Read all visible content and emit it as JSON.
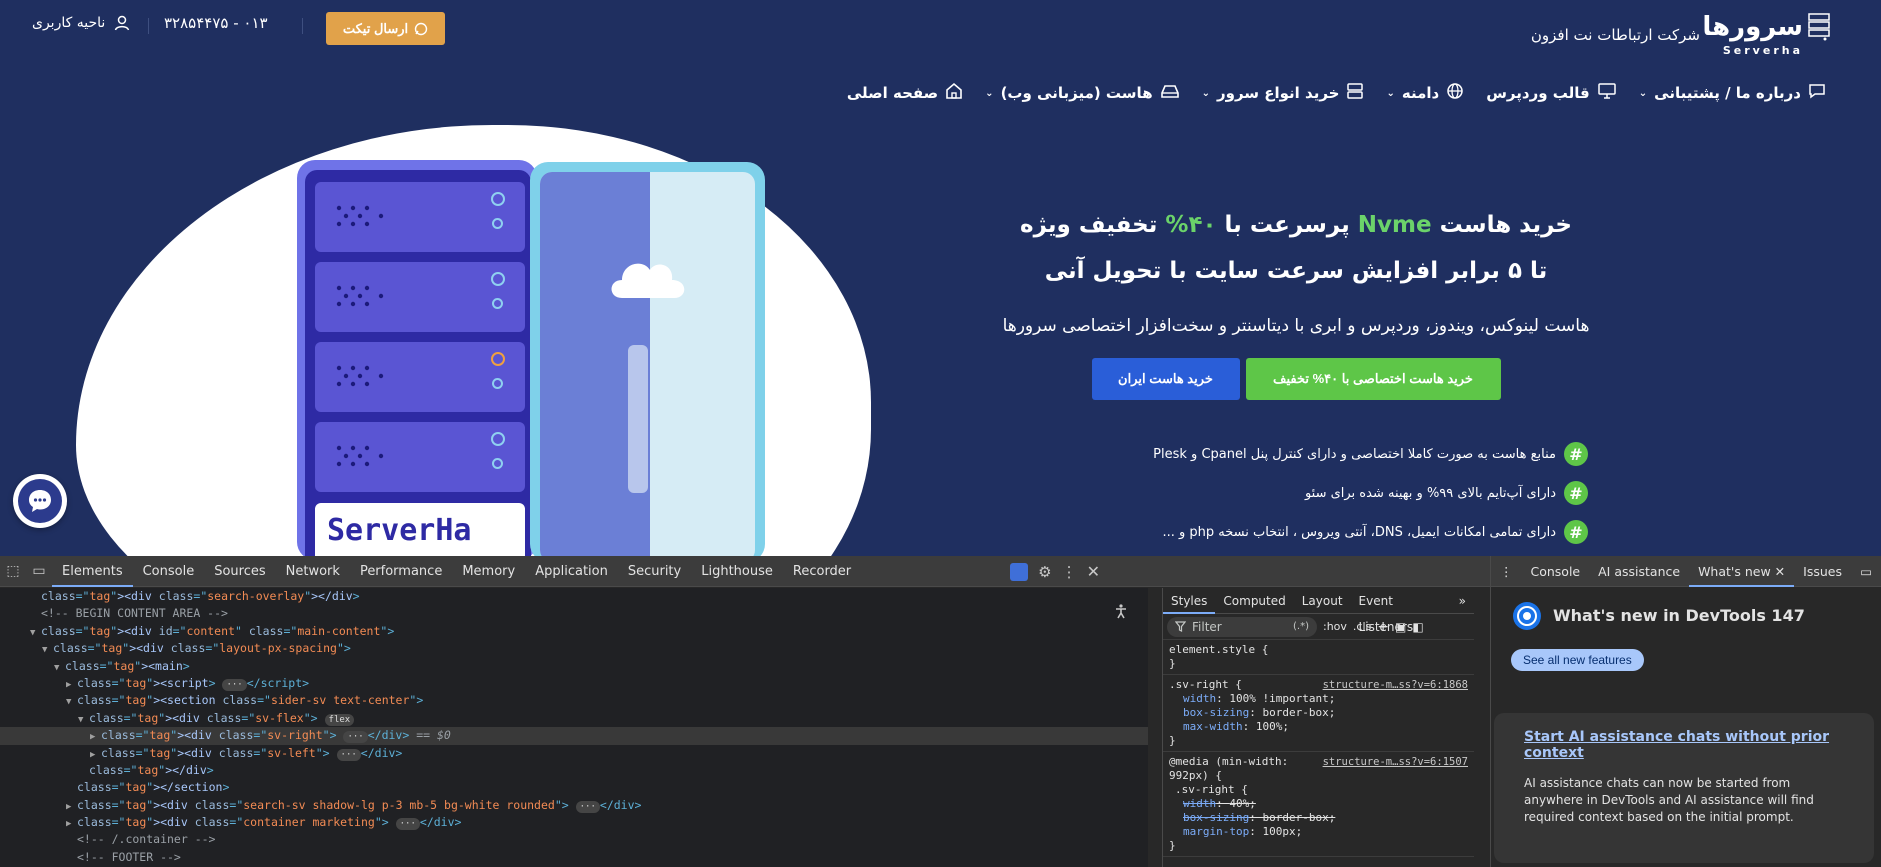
{
  "site": {
    "logo_fa": "سرورها",
    "logo_en": "Serverha",
    "company": "شرکت ارتباطات نت افزون",
    "ticket_button": "ارسال تیکت",
    "phone": "۰۱۳ - ۳۲۸۵۴۴۷۵",
    "user_area": "ناحیه کاربری",
    "nav": [
      {
        "label": "صفحه اصلی",
        "icon": "home-icon",
        "has_menu": false
      },
      {
        "label": "هاست (میزبانی وب)",
        "icon": "hosting-icon",
        "has_menu": true
      },
      {
        "label": "خرید انواع سرور",
        "icon": "server-icon",
        "has_menu": true
      },
      {
        "label": "دامنه",
        "icon": "globe-icon",
        "has_menu": true
      },
      {
        "label": "قالب وردپرس",
        "icon": "template-icon",
        "has_menu": false
      },
      {
        "label": "درباره ما / پشتیبانی",
        "icon": "chat-icon",
        "has_menu": true
      }
    ],
    "hero": {
      "title_part1": "خرید هاست",
      "title_nvme": "Nvme",
      "title_part2": "پرسرعت با",
      "title_percent": "۴۰%",
      "title_part3": "تخفیف ویژه",
      "subtitle": "تا ۵ برابر افزایش سرعت سایت با تحویل آنی",
      "lead": "هاست لینوکس، ویندوز، وردپرس و ابری با دیتاسنتر و سخت‌افزار اختصاصی سرورها",
      "btn_green": "خرید هاست اختصاصی با ۴۰% تخفیف",
      "btn_blue": "خرید هاست ایران"
    },
    "features": [
      "منابع هاست به صورت کاملا اختصاصی و دارای کنترل پنل Cpanel و Plesk",
      "دارای آپ‌تایم بالای ۹۹% و بهینه شده برای سئو",
      "دارای تمامی امکانات ایمیل، DNS، آنتی ویروس ، انتخاب نسخه php و ..."
    ],
    "server_brand": "ServerHa",
    "colors": {
      "bg": "#1f2f60",
      "accent_orange": "#e1a24a",
      "accent_green": "#5ec648",
      "accent_blue": "#2a5ed8"
    }
  },
  "devtools": {
    "tabs": [
      "Elements",
      "Console",
      "Sources",
      "Network",
      "Performance",
      "Memory",
      "Application",
      "Security",
      "Lighthouse",
      "Recorder"
    ],
    "active_tab": "Elements",
    "tree": [
      {
        "indent": 2,
        "caret": "",
        "html": "div_search_overlay"
      },
      {
        "indent": 2,
        "caret": "",
        "html": "comment_begin"
      },
      {
        "indent": 2,
        "caret": "▼",
        "html": "div_content"
      },
      {
        "indent": 3,
        "caret": "▼",
        "html": "div_layout"
      },
      {
        "indent": 4,
        "caret": "▼",
        "html": "main"
      },
      {
        "indent": 5,
        "caret": "▶",
        "html": "script"
      },
      {
        "indent": 5,
        "caret": "▼",
        "html": "section"
      },
      {
        "indent": 6,
        "caret": "▼",
        "html": "div_svflex"
      },
      {
        "indent": 7,
        "caret": "▶",
        "html": "div_svright"
      },
      {
        "indent": 7,
        "caret": "▶",
        "html": "div_svleft"
      },
      {
        "indent": 6,
        "caret": "",
        "html": "close_div"
      },
      {
        "indent": 5,
        "caret": "",
        "html": "close_section"
      },
      {
        "indent": 5,
        "caret": "▶",
        "html": "div_search_sv"
      },
      {
        "indent": 5,
        "caret": "▶",
        "html": "div_container"
      },
      {
        "indent": 5,
        "caret": "",
        "html": "comment_container"
      },
      {
        "indent": 5,
        "caret": "",
        "html": "comment_footer"
      }
    ],
    "tree_text": {
      "div_search_overlay": "<div class=\"search-overlay\"></div>",
      "comment_begin": "<!--  BEGIN CONTENT AREA  -->",
      "div_content": "<div id=\"content\" class=\"main-content\">",
      "div_layout": "<div class=\"layout-px-spacing\">",
      "main": "<main>",
      "script": "<script>",
      "section": "<section class=\"sider-sv text-center\">",
      "div_svflex": "<div class=\"sv-flex\">",
      "div_svright": "<div class=\"sv-right\">",
      "div_svleft": "<div class=\"sv-left\">",
      "close_div": "</div>",
      "close_section": "</section>",
      "div_search_sv": "<div class=\"search-sv shadow-lg p-3 mb-5 bg-white rounded\">",
      "div_container": "<div class=\"container marketing\">",
      "comment_container": "<!-- /.container -->",
      "comment_footer": "<!-- FOOTER -->"
    },
    "flex_badge": "flex",
    "selected_marker": "== $0",
    "ellipsis": "···",
    "styles_tabs": [
      "Styles",
      "Computed",
      "Layout",
      "Event Listeners"
    ],
    "filter_placeholder": "Filter",
    "filter_hov": ":hov",
    "filter_cls": ".cls",
    "rules": {
      "element_style": "element.style {",
      "close": "}",
      "r1_selector": ".sv-right {",
      "r1_source": "structure-m…ss?v=6:1868",
      "r1_props": [
        {
          "name": "width",
          "value": "100% !important;"
        },
        {
          "name": "box-sizing",
          "value": "border-box;"
        },
        {
          "name": "max-width",
          "value": "100%;"
        }
      ],
      "r2_media": "@media (min-width: 992px) {",
      "r2_source": "structure-m…ss?v=6:1507",
      "r2_selector": ".sv-right {",
      "r2_props": [
        {
          "name": "width",
          "value": "40%;",
          "struck": true
        },
        {
          "name": "box-sizing",
          "value": "border-box;",
          "struck": true
        },
        {
          "name": "margin-top",
          "value": "100px;",
          "struck": false
        }
      ]
    },
    "drawer_tabs": [
      "Console",
      "AI assistance",
      "What's new",
      "Issues"
    ],
    "drawer_active": "What's new",
    "whats_new_title": "What's new in DevTools 147",
    "see_all": "See all new features",
    "card_title": "Start AI assistance chats without prior context",
    "card_text": "AI assistance chats can now be started from anywhere in DevTools and AI assistance will find required context based on the initial prompt."
  }
}
